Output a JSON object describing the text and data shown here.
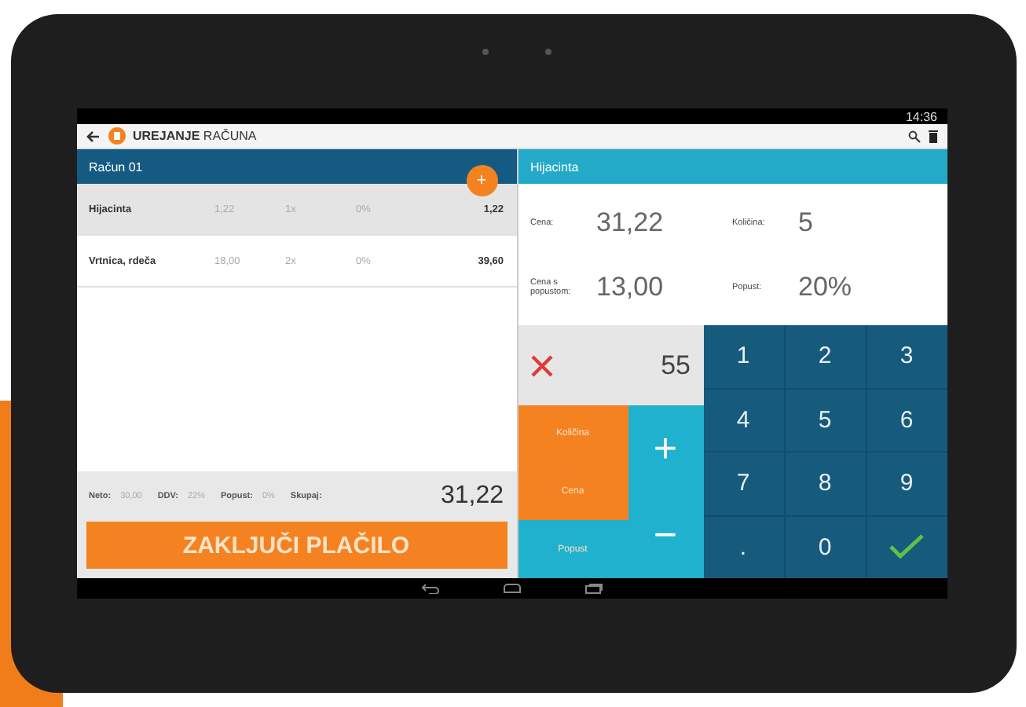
{
  "status_bar": {
    "time": "14:36"
  },
  "action_bar": {
    "title_bold": "UREJANJE",
    "title_light": "RAČUNA"
  },
  "bill": {
    "title": "Račun 01",
    "add_button": "+",
    "rows": [
      {
        "name": "Hijacinta",
        "price": "1,22",
        "qty": "1x",
        "discount": "0%",
        "total": "1,22",
        "selected": true
      },
      {
        "name": "Vrtnica, rdeča",
        "price": "18,00",
        "qty": "2x",
        "discount": "0%",
        "total": "39,60",
        "selected": false
      }
    ],
    "summary": [
      {
        "label": "Neto:",
        "value": "30,00"
      },
      {
        "label": "DDV:",
        "value": "22%"
      },
      {
        "label": "Popust:",
        "value": "0%"
      },
      {
        "label": "Skupaj:"
      }
    ],
    "total": "31,22",
    "pay_button": "ZAKLJUČI PLAČILO"
  },
  "item": {
    "title": "Hijacinta",
    "fields": [
      {
        "label": "Cena:",
        "value": "31,22"
      },
      {
        "label": "Količina:",
        "value": "5"
      },
      {
        "label": "Cena s popustom:",
        "value": "13,00"
      },
      {
        "label": "Popust:",
        "value": "20%"
      }
    ],
    "input": "55",
    "modes": [
      {
        "label": "Količina",
        "selected": true
      },
      {
        "label": "Cena",
        "selected": true
      },
      {
        "label": "Popust",
        "selected": false
      }
    ],
    "plus": "+",
    "minus": "−",
    "keys": [
      "1",
      "2",
      "3",
      "4",
      "5",
      "6",
      "7",
      "8",
      "9",
      ".",
      "0"
    ]
  }
}
